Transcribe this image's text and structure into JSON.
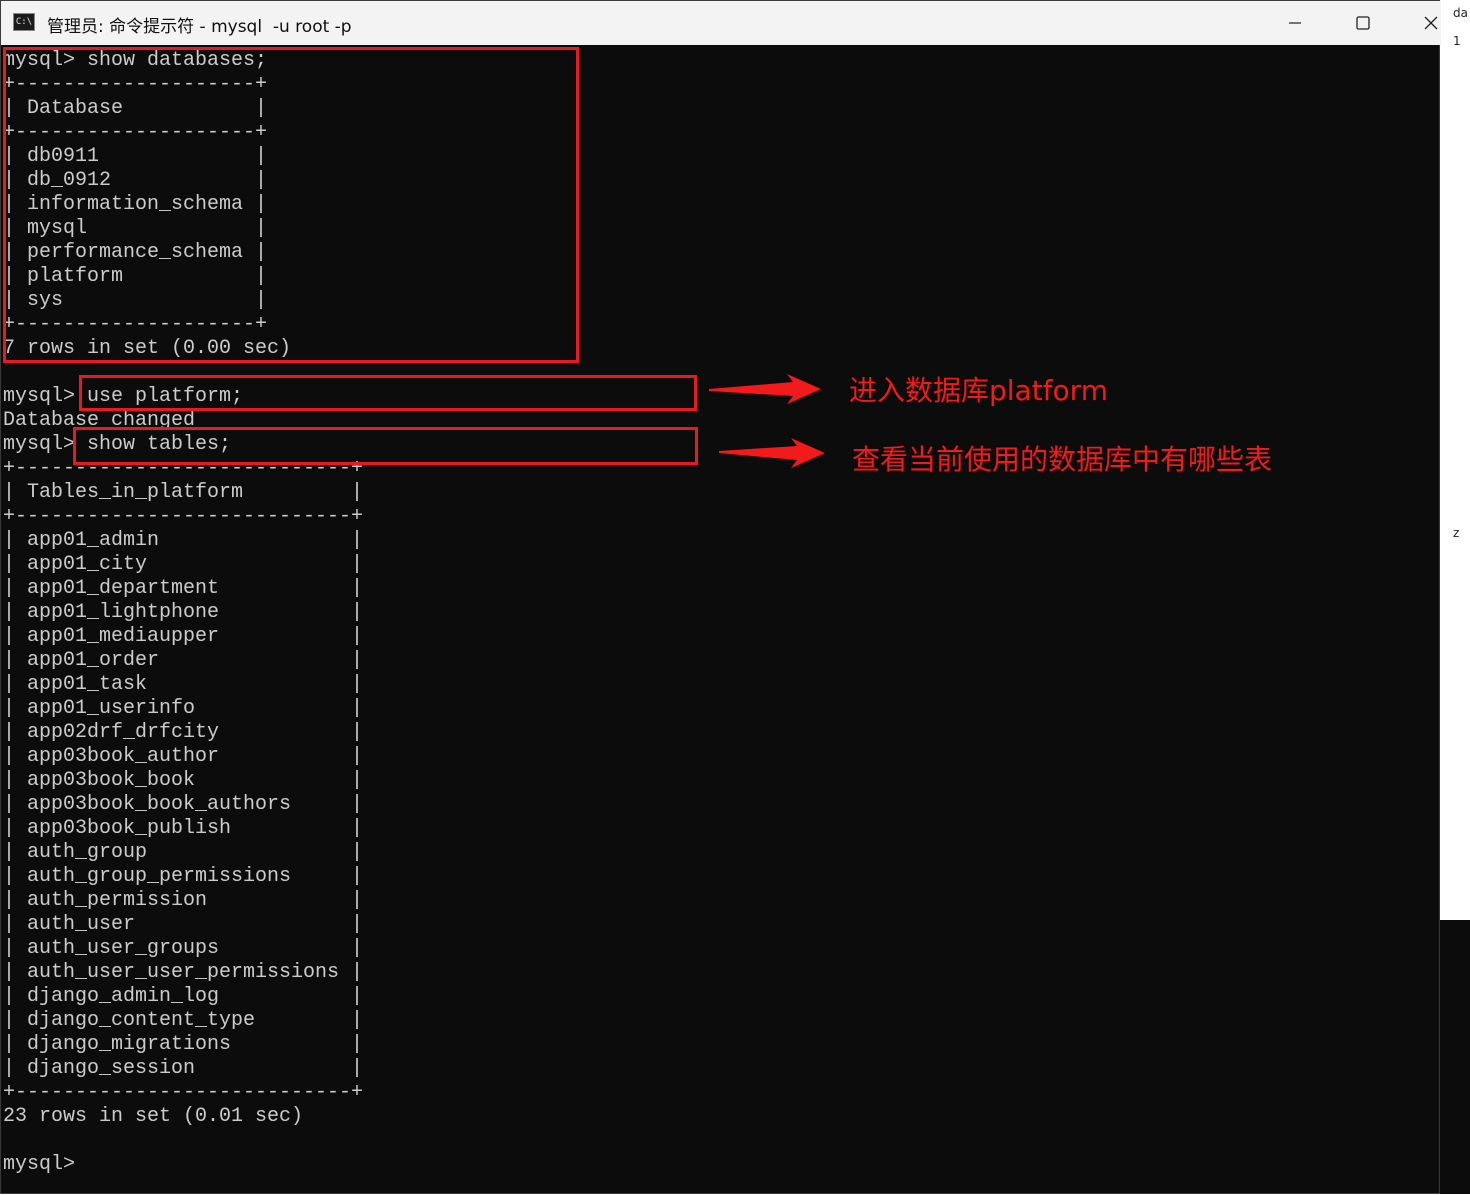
{
  "window": {
    "title": "管理员: 命令提示符 - mysql  -u root -p",
    "icon_text": "C:\\",
    "controls": [
      "minimize-icon",
      "maximize-icon",
      "close-icon"
    ]
  },
  "background_fragments": [
    "da",
    "1",
    "z"
  ],
  "terminal": {
    "lines": [
      "mysql> show databases;",
      "+--------------------+",
      "| Database           |",
      "+--------------------+",
      "| db0911             |",
      "| db_0912            |",
      "| information_schema |",
      "| mysql              |",
      "| performance_schema |",
      "| platform           |",
      "| sys                |",
      "+--------------------+",
      "7 rows in set (0.00 sec)",
      "",
      "mysql> use platform;",
      "Database changed",
      "mysql> show tables;",
      "+----------------------------+",
      "| Tables_in_platform         |",
      "+----------------------------+",
      "| app01_admin                |",
      "| app01_city                 |",
      "| app01_department           |",
      "| app01_lightphone           |",
      "| app01_mediaupper           |",
      "| app01_order                |",
      "| app01_task                 |",
      "| app01_userinfo             |",
      "| app02drf_drfcity           |",
      "| app03book_author           |",
      "| app03book_book             |",
      "| app03book_book_authors     |",
      "| app03book_publish          |",
      "| auth_group                 |",
      "| auth_group_permissions     |",
      "| auth_permission            |",
      "| auth_user                  |",
      "| auth_user_groups           |",
      "| auth_user_user_permissions |",
      "| django_admin_log           |",
      "| django_content_type        |",
      "| django_migrations          |",
      "| django_session             |",
      "+----------------------------+",
      "23 rows in set (0.01 sec)",
      "",
      "mysql>"
    ]
  },
  "annotations": {
    "use_note": "进入数据库platform",
    "tables_note": "查看当前使用的数据库中有哪些表",
    "color": "#f21a1a"
  }
}
